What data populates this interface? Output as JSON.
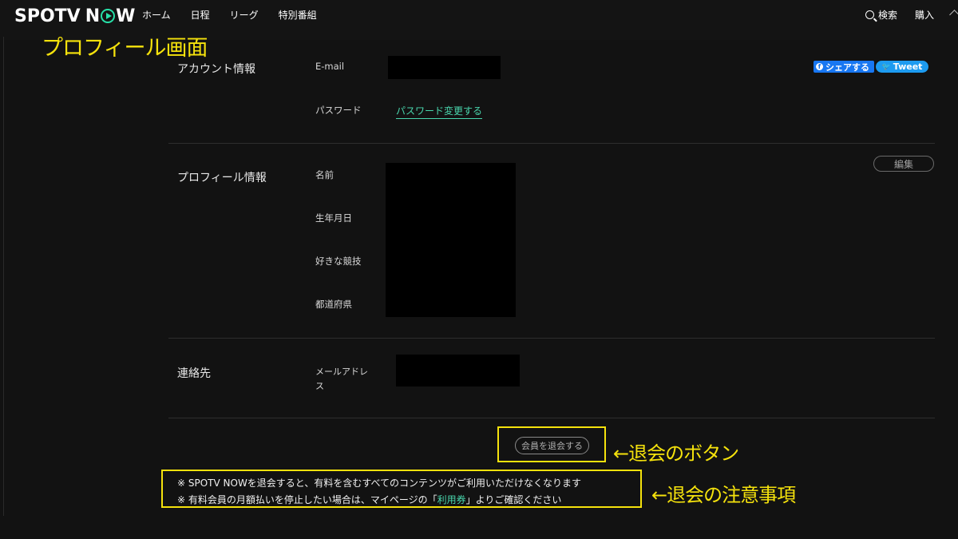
{
  "header": {
    "logo_left": "SPOTV",
    "logo_n": "N",
    "logo_w": "W",
    "nav": [
      "ホーム",
      "日程",
      "リーグ",
      "特別番組"
    ],
    "search_label": "検索",
    "purchase_label": "購入"
  },
  "annotations": {
    "title": "プロフィール画面",
    "withdraw_button_note": "←退会のボタン",
    "notice_note": "←退会の注意事項"
  },
  "account": {
    "section_title": "アカウント情報",
    "email_label": "E-mail",
    "password_label": "パスワード",
    "password_link": "パスワード変更する"
  },
  "share": {
    "facebook_label": "シェアする",
    "twitter_label": "Tweet"
  },
  "profile": {
    "section_title": "プロフィール情報",
    "edit_label": "編集",
    "fields": [
      "名前",
      "生年月日",
      "好きな競技",
      "都道府県"
    ]
  },
  "contact": {
    "section_title": "連絡先",
    "mail_label": "メールアドレス"
  },
  "withdraw": {
    "button_label": "会員を退会する",
    "notice_1": "※ SPOTV NOWを退会すると、有料を含むすべてのコンテンツがご利用いただけなくなります",
    "notice_2_pre": "※ 有料会員の月額払いを停止したい場合は、マイページの「",
    "notice_2_link": "利用券",
    "notice_2_post": "」よりご確認ください"
  },
  "colors": {
    "accent": "#49d6ad",
    "annotation": "#f5e20c",
    "background": "#121212"
  }
}
